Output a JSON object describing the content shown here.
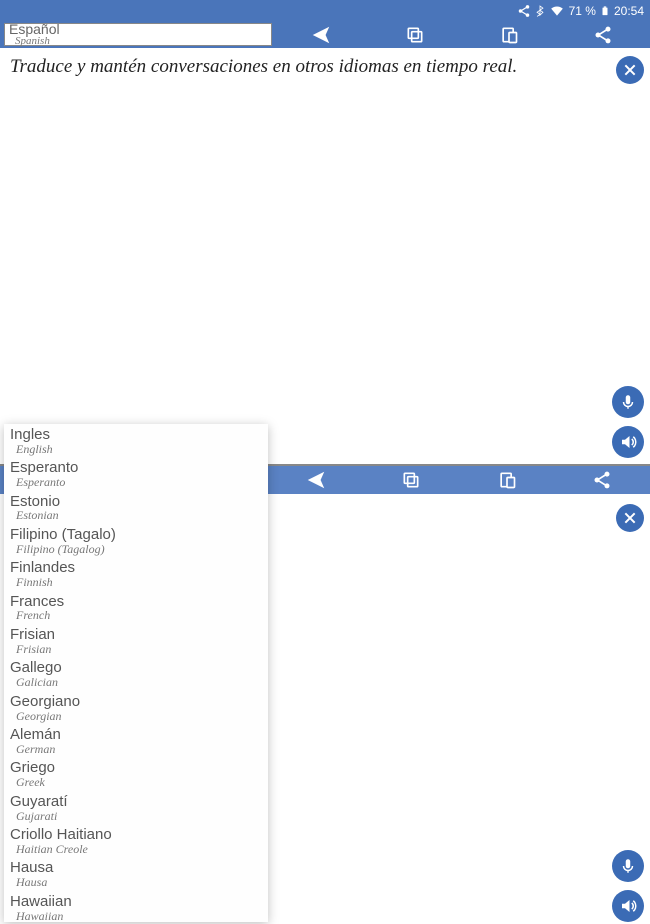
{
  "status": {
    "battery_pct": "71 %",
    "time": "20:54"
  },
  "top_language": {
    "primary": "Español",
    "secondary": "Spanish"
  },
  "tagline": "Traduce y mantén conversaciones en otros idiomas en tiempo real.",
  "dropdown": [
    {
      "primary": "Ingles",
      "secondary": "English"
    },
    {
      "primary": "Esperanto",
      "secondary": "Esperanto"
    },
    {
      "primary": "Estonio",
      "secondary": "Estonian"
    },
    {
      "primary": "Filipino (Tagalo)",
      "secondary": "Filipino (Tagalog)"
    },
    {
      "primary": "Finlandes",
      "secondary": "Finnish"
    },
    {
      "primary": "Frances",
      "secondary": "French"
    },
    {
      "primary": "Frisian",
      "secondary": "Frisian"
    },
    {
      "primary": "Gallego",
      "secondary": "Galician"
    },
    {
      "primary": "Georgiano",
      "secondary": "Georgian"
    },
    {
      "primary": "Alemán",
      "secondary": "German"
    },
    {
      "primary": "Griego",
      "secondary": "Greek"
    },
    {
      "primary": "Guyaratí",
      "secondary": "Gujarati"
    },
    {
      "primary": "Criollo Haitiano",
      "secondary": "Haitian Creole"
    },
    {
      "primary": "Hausa",
      "secondary": "Hausa"
    },
    {
      "primary": "Hawaiian",
      "secondary": "Hawaiian"
    }
  ]
}
